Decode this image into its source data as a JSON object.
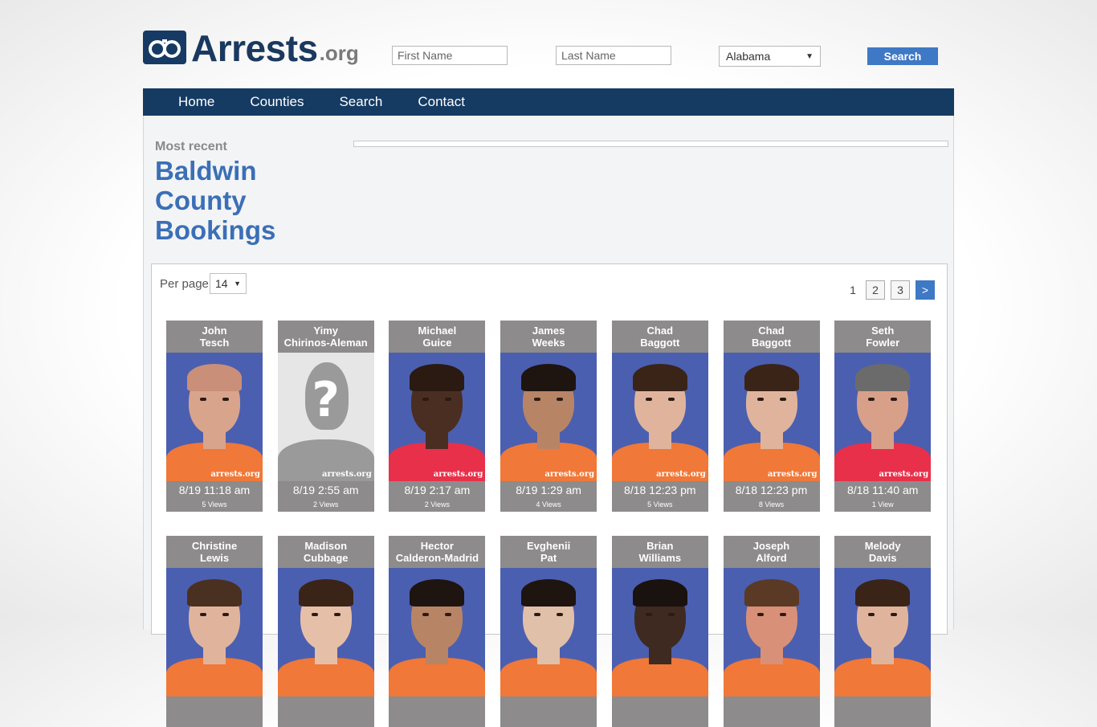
{
  "brand": {
    "name": "Arrests",
    "tld": ".org"
  },
  "header": {
    "first_name_placeholder": "First Name",
    "last_name_placeholder": "Last Name",
    "state_selected": "Alabama",
    "search_label": "Search"
  },
  "nav": [
    "Home",
    "Counties",
    "Search",
    "Contact"
  ],
  "section": {
    "eyebrow": "Most recent",
    "title_lines": [
      "Baldwin",
      "County",
      "Bookings"
    ]
  },
  "list_controls": {
    "per_page_label": "Per page",
    "per_page_value": "14",
    "pages": [
      "1",
      "2",
      "3",
      ">"
    ],
    "current_page": "1"
  },
  "watermark": "arrests.org",
  "bookings_row1": [
    {
      "first": "John",
      "last": "Tesch",
      "date": "8/19 11:18 am",
      "views": "5 Views",
      "skin": "#d9a48c",
      "hair": "#c98f78",
      "shirt": "#f07838"
    },
    {
      "first": "Yimy",
      "last": "Chirinos-Aleman",
      "date": "8/19 2:55 am",
      "views": "2 Views",
      "unknown": true
    },
    {
      "first": "Michael",
      "last": "Guice",
      "date": "8/19 2:17 am",
      "views": "2 Views",
      "skin": "#4a2e22",
      "hair": "#2a1a12",
      "shirt": "#e8304a"
    },
    {
      "first": "James",
      "last": "Weeks",
      "date": "8/19 1:29 am",
      "views": "4 Views",
      "skin": "#b88466",
      "hair": "#1e1410",
      "shirt": "#f07838"
    },
    {
      "first": "Chad",
      "last": "Baggott",
      "date": "8/18 12:23 pm",
      "views": "5 Views",
      "skin": "#e0b49c",
      "hair": "#3a2418",
      "shirt": "#f07838"
    },
    {
      "first": "Chad",
      "last": "Baggott",
      "date": "8/18 12:23 pm",
      "views": "8 Views",
      "skin": "#e0b49c",
      "hair": "#3a2418",
      "shirt": "#f07838"
    },
    {
      "first": "Seth",
      "last": "Fowler",
      "date": "8/18 11:40 am",
      "views": "1 View",
      "skin": "#d8a088",
      "hair": "#6b6b6b",
      "shirt": "#e8304a"
    }
  ],
  "bookings_row2": [
    {
      "first": "Christine",
      "last": "Lewis",
      "skin": "#e0b49c",
      "hair": "#4a3020"
    },
    {
      "first": "Madison",
      "last": "Cubbage",
      "skin": "#e6bfa8",
      "hair": "#3a2418"
    },
    {
      "first": "Hector",
      "last": "Calderon-Madrid",
      "skin": "#b88466",
      "hair": "#1e1410"
    },
    {
      "first": "Evghenii",
      "last": "Pat",
      "skin": "#e0c0a8",
      "hair": "#1e1410"
    },
    {
      "first": "Brian",
      "last": "Williams",
      "skin": "#3e2a20",
      "hair": "#1a120e"
    },
    {
      "first": "Joseph",
      "last": "Alford",
      "skin": "#d89078",
      "hair": "#5a3a24"
    },
    {
      "first": "Melody",
      "last": "Davis",
      "skin": "#e0b49c",
      "hair": "#3a2418"
    }
  ]
}
